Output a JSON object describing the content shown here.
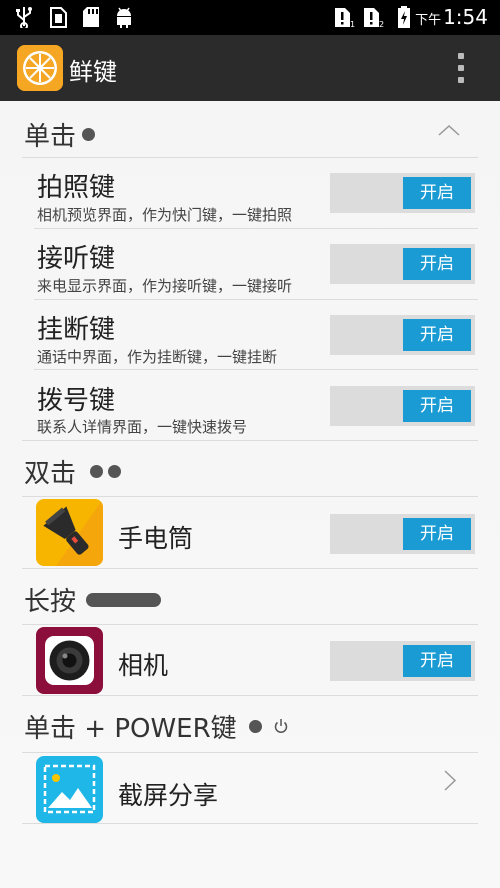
{
  "status_bar": {
    "time_prefix": "下午",
    "time": "1:54",
    "icons": [
      "usb-icon",
      "sim-card-icon",
      "sd-card-icon",
      "android-debug-icon",
      "sim1-no-signal-icon",
      "sim2-no-signal-icon",
      "battery-charging-icon"
    ]
  },
  "app_bar": {
    "title": "鲜键",
    "logo_icon": "orange-slice-icon",
    "menu_icon": "more-vert-icon"
  },
  "colors": {
    "accent": "#1a9bd4",
    "toggle_track": "#dcdcdc",
    "app_bar": "#2b2b2b"
  },
  "sections": {
    "single": {
      "title": "单击",
      "collapse_icon": "chevron-up-icon",
      "items": [
        {
          "title": "拍照键",
          "desc": "相机预览界面，作为快门键，一键拍照",
          "toggle": "开启"
        },
        {
          "title": "接听键",
          "desc": "来电显示界面，作为接听键，一键接听",
          "toggle": "开启"
        },
        {
          "title": "挂断键",
          "desc": "通话中界面，作为挂断键，一键挂断",
          "toggle": "开启"
        },
        {
          "title": "拨号键",
          "desc": "联系人详情界面，一键快速拨号",
          "toggle": "开启"
        }
      ]
    },
    "double": {
      "title": "双击",
      "item": {
        "label": "手电筒",
        "icon": "flashlight-icon",
        "toggle": "开启"
      }
    },
    "long": {
      "title": "长按",
      "item": {
        "label": "相机",
        "icon": "camera-icon",
        "toggle": "开启"
      }
    },
    "power": {
      "title": "单击 + POWER键",
      "item": {
        "label": "截屏分享",
        "icon": "screenshot-share-icon"
      }
    }
  }
}
